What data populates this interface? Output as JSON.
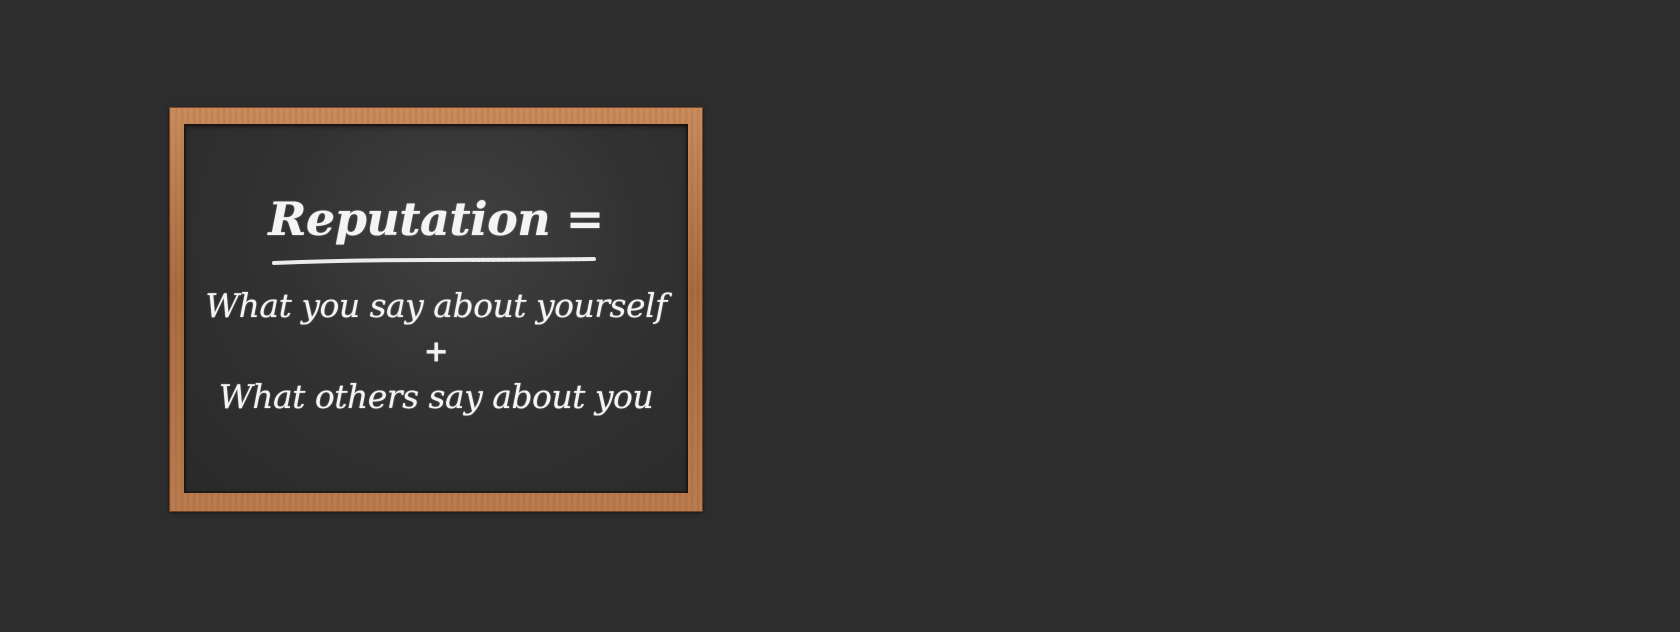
{
  "chalkboard": {
    "title": "Reputation =",
    "line1": "What you say about yourself",
    "operator": "+",
    "line2": "What others say about you"
  },
  "colors": {
    "background": "#2c2d2c",
    "frame_wood": "#b97a4c",
    "board": "#333333",
    "chalk": "#f4f4f2"
  }
}
